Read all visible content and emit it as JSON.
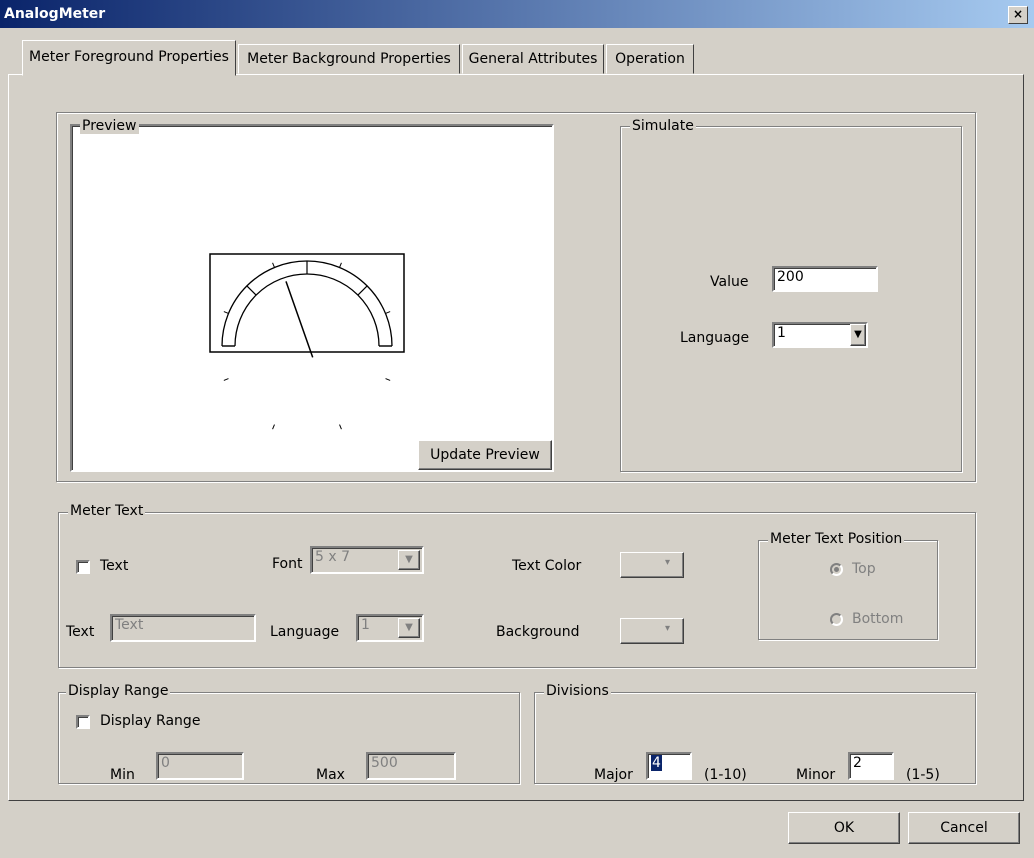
{
  "window": {
    "title": "AnalogMeter",
    "close_glyph": "×"
  },
  "tabs": [
    {
      "label": "Meter Foreground Properties",
      "active": true
    },
    {
      "label": "Meter Background Properties"
    },
    {
      "label": "General Attributes"
    },
    {
      "label": "Operation"
    }
  ],
  "preview": {
    "label": "Preview",
    "update_button": "Update Preview",
    "needle_value": 200,
    "range_min": 0,
    "range_max": 500,
    "major_divisions": 4
  },
  "simulate": {
    "label": "Simulate",
    "value_label": "Value",
    "value": "200",
    "language_label": "Language",
    "language": "1"
  },
  "meter_text": {
    "label": "Meter Text",
    "text_checkbox": "Text",
    "text_checked": false,
    "font_label": "Font",
    "font_value": "5 x 7",
    "text_color_label": "Text Color",
    "text_label": "Text",
    "text_value": "Text",
    "language_label": "Language",
    "language_value": "1",
    "background_label": "Background",
    "position": {
      "label": "Meter Text  Position",
      "top": "Top",
      "bottom": "Bottom",
      "selected": "Top"
    }
  },
  "display_range": {
    "label": "Display Range",
    "checkbox": "Display Range",
    "checked": false,
    "min_label": "Min",
    "min_value": "0",
    "max_label": "Max",
    "max_value": "500"
  },
  "divisions": {
    "label": "Divisions",
    "major_label": "Major",
    "major_value": "4",
    "major_hint": "(1-10)",
    "minor_label": "Minor",
    "minor_value": "2",
    "minor_hint": "(1-5)"
  },
  "footer": {
    "ok": "OK",
    "cancel": "Cancel"
  }
}
